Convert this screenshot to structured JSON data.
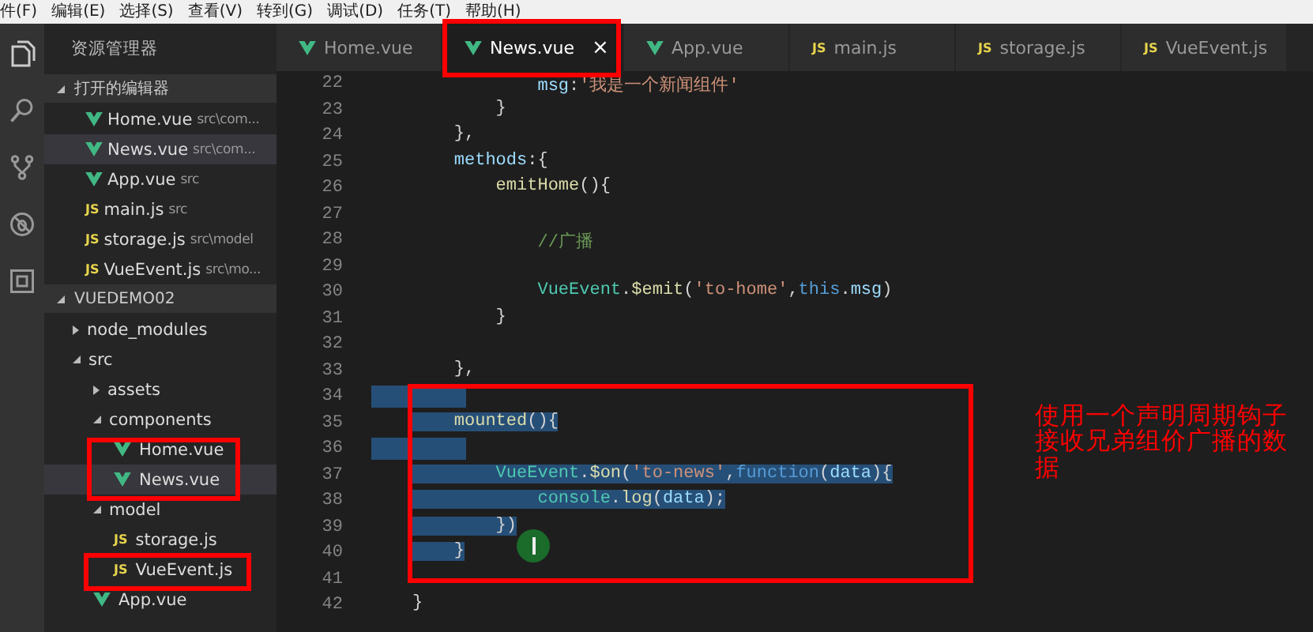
{
  "menu_bar": [
    "件(F)",
    "编辑(E)",
    "选择(S)",
    "查看(V)",
    "转到(G)",
    "调试(D)",
    "任务(T)",
    "帮助(H)"
  ],
  "sidebar": {
    "title": "资源管理器",
    "open_editors": {
      "title": "打开的编辑器",
      "expanded": true,
      "items": [
        {
          "name": "Home.vue",
          "path": "src\\com...",
          "kind": "vue",
          "selected": false
        },
        {
          "name": "News.vue",
          "path": "src\\com...",
          "kind": "vue",
          "selected": true
        },
        {
          "name": "App.vue",
          "path": "src",
          "kind": "vue",
          "selected": false
        },
        {
          "name": "main.js",
          "path": "src",
          "kind": "js",
          "icon": "JS",
          "selected": false
        },
        {
          "name": "storage.js",
          "path": "src\\model",
          "kind": "js",
          "icon": "JS",
          "selected": false
        },
        {
          "name": "VueEvent.js",
          "path": "src\\mo...",
          "kind": "js",
          "icon": "JS",
          "selected": false
        }
      ]
    },
    "project": {
      "title": "VUEDEMO02",
      "expanded": true,
      "children": [
        {
          "name": "node_modules",
          "kind": "folder",
          "expanded": false
        },
        {
          "name": "src",
          "kind": "folder",
          "expanded": true,
          "children": [
            {
              "name": "assets",
              "kind": "folder",
              "expanded": false
            },
            {
              "name": "components",
              "kind": "folder",
              "expanded": true,
              "children": [
                {
                  "name": "Home.vue",
                  "kind": "vue",
                  "selected": false
                },
                {
                  "name": "News.vue",
                  "kind": "vue",
                  "selected": true
                }
              ]
            },
            {
              "name": "model",
              "kind": "folder",
              "expanded": true,
              "children": [
                {
                  "name": "storage.js",
                  "kind": "js",
                  "icon": "JS",
                  "selected": false
                },
                {
                  "name": "VueEvent.js",
                  "kind": "js",
                  "icon": "JS",
                  "selected": false
                }
              ]
            },
            {
              "name": "App.vue",
              "kind": "vue",
              "selected": false
            }
          ]
        }
      ]
    }
  },
  "tabs": [
    {
      "label": "Home.vue",
      "kind": "vue",
      "selected": false
    },
    {
      "label": "News.vue",
      "kind": "vue",
      "selected": true,
      "close": "×"
    },
    {
      "label": "App.vue",
      "kind": "vue",
      "selected": false
    },
    {
      "label": "main.js",
      "kind": "js",
      "icon": "JS",
      "selected": false
    },
    {
      "label": "storage.js",
      "kind": "js",
      "icon": "JS",
      "selected": false
    },
    {
      "label": "VueEvent.js",
      "kind": "js",
      "icon": "JS",
      "selected": false
    }
  ],
  "code": [
    {
      "number": "22",
      "selected": false,
      "tokens": [
        {
          "kind": "prop",
          "text": "            msg"
        },
        {
          "kind": "plain",
          "text": ":"
        },
        {
          "kind": "str",
          "text": "'我是一个新闻组件'"
        }
      ]
    },
    {
      "number": "23",
      "selected": false,
      "tokens": [
        {
          "kind": "plain",
          "text": "        }"
        }
      ]
    },
    {
      "number": "24",
      "selected": false,
      "tokens": [
        {
          "kind": "plain",
          "text": "    },"
        }
      ]
    },
    {
      "number": "25",
      "selected": false,
      "tokens": [
        {
          "kind": "prop",
          "text": "    methods"
        },
        {
          "kind": "plain",
          "text": ":{"
        }
      ]
    },
    {
      "number": "26",
      "selected": false,
      "tokens": [
        {
          "kind": "func",
          "text": "        emitHome"
        },
        {
          "kind": "plain",
          "text": "(){"
        }
      ]
    },
    {
      "number": "27",
      "selected": false
    },
    {
      "number": "28",
      "selected": false,
      "tokens": [
        {
          "kind": "cmt",
          "text": "            //广播"
        }
      ]
    },
    {
      "number": "29",
      "selected": false
    },
    {
      "number": "30",
      "selected": false,
      "tokens": [
        {
          "kind": "cls",
          "text": "            VueEvent"
        },
        {
          "kind": "plain",
          "text": "."
        },
        {
          "kind": "func",
          "text": "$emit"
        },
        {
          "kind": "plain",
          "text": "("
        },
        {
          "kind": "str",
          "text": "'to-home'"
        },
        {
          "kind": "plain",
          "text": ","
        },
        {
          "kind": "kw",
          "text": "this"
        },
        {
          "kind": "plain",
          "text": "."
        },
        {
          "kind": "prop",
          "text": "msg"
        },
        {
          "kind": "plain",
          "text": ")"
        }
      ]
    },
    {
      "number": "31",
      "selected": false,
      "tokens": [
        {
          "kind": "plain",
          "text": "        }"
        }
      ]
    },
    {
      "number": "32",
      "selected": false
    },
    {
      "number": "33",
      "selected": false,
      "tokens": [
        {
          "kind": "plain",
          "text": "    },"
        }
      ]
    },
    {
      "number": "34",
      "selected": true
    },
    {
      "number": "35",
      "selected": true,
      "tokens": [
        {
          "kind": "func",
          "text": "    mounted"
        },
        {
          "kind": "plain",
          "text": "(){"
        }
      ]
    },
    {
      "number": "36",
      "selected": true
    },
    {
      "number": "37",
      "selected": true,
      "tokens": [
        {
          "kind": "cls",
          "text": "        VueEvent"
        },
        {
          "kind": "plain",
          "text": "."
        },
        {
          "kind": "func",
          "text": "$on"
        },
        {
          "kind": "plain",
          "text": "("
        },
        {
          "kind": "str",
          "text": "'to-news'"
        },
        {
          "kind": "plain",
          "text": ","
        },
        {
          "kind": "kw",
          "text": "function"
        },
        {
          "kind": "plain",
          "text": "("
        },
        {
          "kind": "prop",
          "text": "data"
        },
        {
          "kind": "plain",
          "text": "){"
        }
      ]
    },
    {
      "number": "38",
      "selected": true,
      "tokens": [
        {
          "kind": "cls",
          "text": "            console"
        },
        {
          "kind": "plain",
          "text": "."
        },
        {
          "kind": "func",
          "text": "log"
        },
        {
          "kind": "plain",
          "text": "("
        },
        {
          "kind": "prop",
          "text": "data"
        },
        {
          "kind": "plain",
          "text": ");"
        }
      ]
    },
    {
      "number": "39",
      "selected": true,
      "tokens": [
        {
          "kind": "plain",
          "text": "        })"
        }
      ]
    },
    {
      "number": "40",
      "selected": true,
      "tokens": [
        {
          "kind": "plain",
          "text": "    }"
        }
      ]
    },
    {
      "number": "41",
      "selected": false
    },
    {
      "number": "42",
      "selected": false,
      "tokens": [
        {
          "kind": "plain",
          "text": "}"
        }
      ]
    }
  ],
  "annotation": {
    "text": "使用一个声明周期钩子接收兄弟组价广播的数据"
  }
}
